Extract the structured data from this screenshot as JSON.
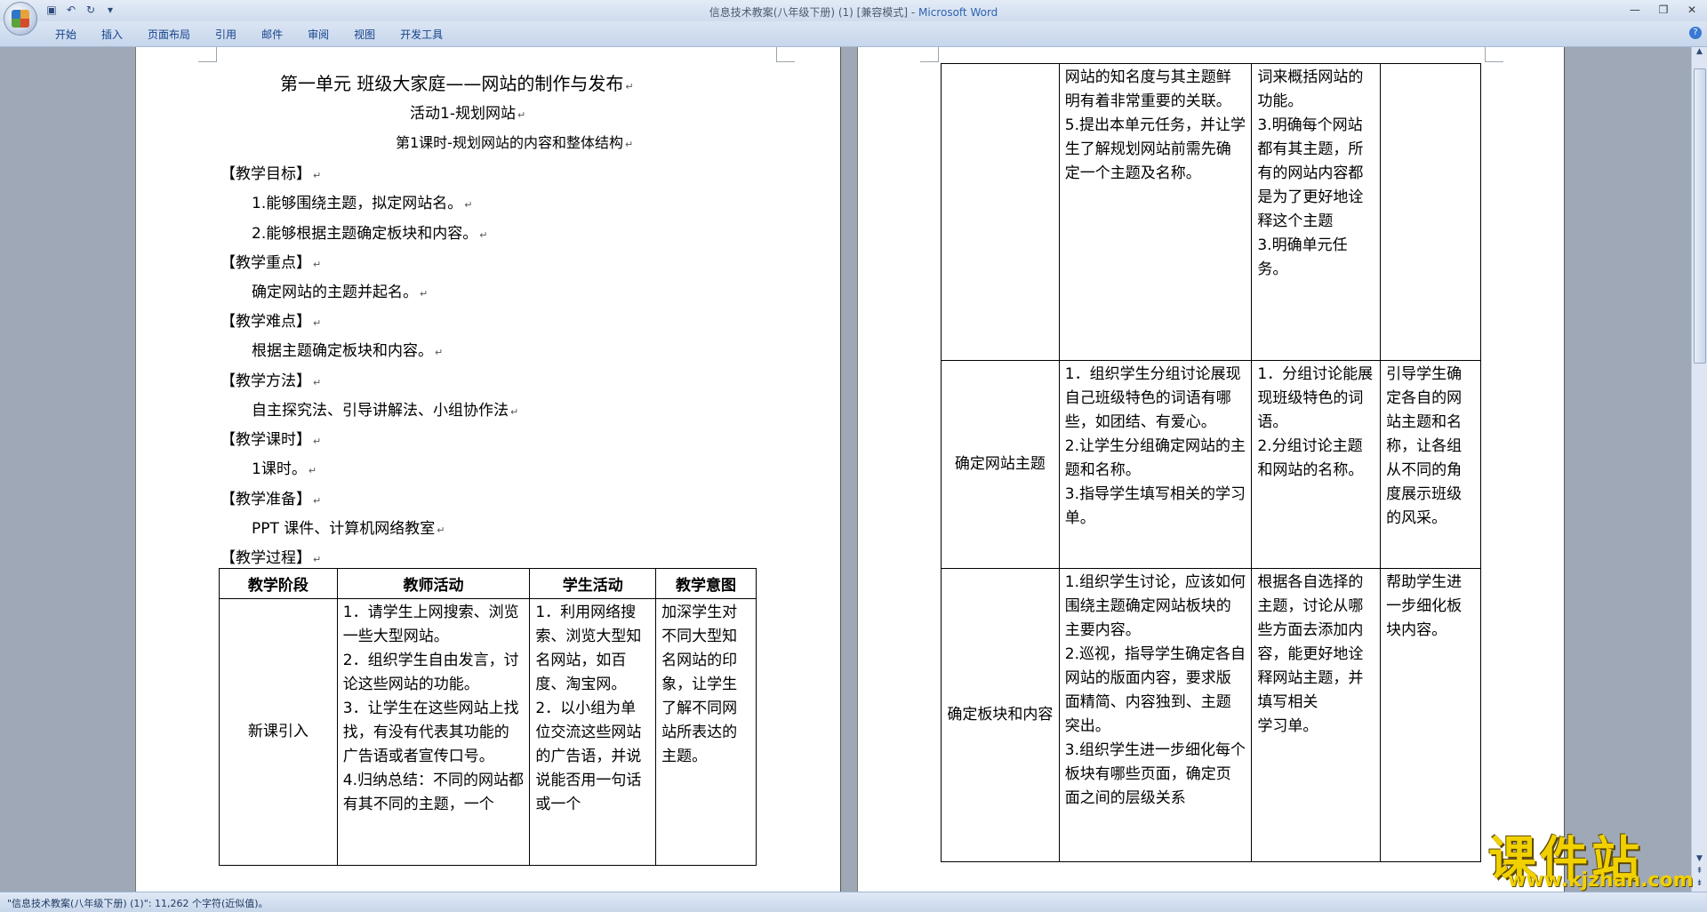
{
  "window": {
    "title_doc": "信息技术教案(八年级下册) (1) [兼容模式] - ",
    "title_app": "Microsoft Word"
  },
  "ribbon": {
    "tabs": [
      "开始",
      "插入",
      "页面布局",
      "引用",
      "邮件",
      "审阅",
      "视图",
      "开发工具"
    ]
  },
  "doc_left": {
    "title": "第一单元  班级大家庭——网站的制作与发布",
    "subtitle": "活动1-规划网站",
    "lesson": "第1课时-规划网站的内容和整体结构",
    "goal_head": "【教学目标】",
    "goal1": "1.能够围绕主题，拟定网站名。",
    "goal2": "2.能够根据主题确定板块和内容。",
    "key_head": "【教学重点】",
    "key1": "确定网站的主题并起名。",
    "diff_head": "【教学难点】",
    "diff1": "根据主题确定板块和内容。",
    "method_head": "【教学方法】",
    "method1": "自主探究法、引导讲解法、小组协作法",
    "hours_head": "【教学课时】",
    "hours1": "1课时。",
    "prep_head": "【教学准备】",
    "prep1": "PPT 课件、计算机网络教室",
    "process_head": "【教学过程】",
    "table": {
      "headers": [
        "教学阶段",
        "教师活动",
        "学生活动",
        "教学意图"
      ],
      "row1_stage": "新课引入",
      "row1_teacher": [
        "1．请学生上网搜索、浏览一些大型网站。",
        "2．组织学生自由发言，讨论这些网站的功能。",
        "3．让学生在这些网站上找找，有没有代表其功能的广告语或者宣传口号。",
        "4.归纳总结：不同的网站都有其不同的主题，一个"
      ],
      "row1_student": [
        "1．利用网络搜索、浏览大型知名网站，如百度、淘宝网。",
        "2．以小组为单位交流这些网站的广告语，并说说能否用一句话或一个"
      ],
      "row1_intent": "加深学生对不同大型知名网站的印象，让学生了解不同网站所表达的主题。"
    }
  },
  "doc_right": {
    "row0_teacher": [
      "网站的知名度与其主题鲜明有着非常重要的关联。",
      "5.提出本单元任务，并让学生了解规划网站前需先确定一个主题及名称。"
    ],
    "row0_student": [
      "词来概括网站的功能。",
      "3.明确每个网站都有其主题，所有的网站内容都是为了更好地诠释这个主题",
      "3.明确单元任务。"
    ],
    "row1_stage": "确定网站主题",
    "row1_teacher": [
      "1．组织学生分组讨论展现自己班级特色的词语有哪些，如团结、有爱心。",
      "2.让学生分组确定网站的主题和名称。",
      "3.指导学生填写相关的学习单。"
    ],
    "row1_student": [
      "1．分组讨论能展现班级特色的词语。",
      "2.分组讨论主题和网站的名称。"
    ],
    "row1_intent": "引导学生确定各自的网站主题和名称，让各组从不同的角度展示班级的风采。",
    "row2_stage": "确定板块和内容",
    "row2_teacher": [
      "1.组织学生讨论，应该如何围绕主题确定网站板块的主要内容。",
      "2.巡视，指导学生确定各自网站的版面内容，要求版面精简、内容独到、主题突出。",
      "3.组织学生进一步细化每个板块有哪些页面，确定页面之间的层级关系"
    ],
    "row2_student": [
      "根据各自选择的主题，讨论从哪些方面去添加内容，能更好地诠释网站主题，并填写相关",
      "学习单。"
    ],
    "row2_intent": "帮助学生进一步细化板块内容。"
  },
  "status": {
    "text": "\"信息技术教案(八年级下册) (1)\": 11,262 个字符(近似值)。"
  },
  "watermark": {
    "title": "课件站",
    "url": "www.kjzhan.com"
  }
}
